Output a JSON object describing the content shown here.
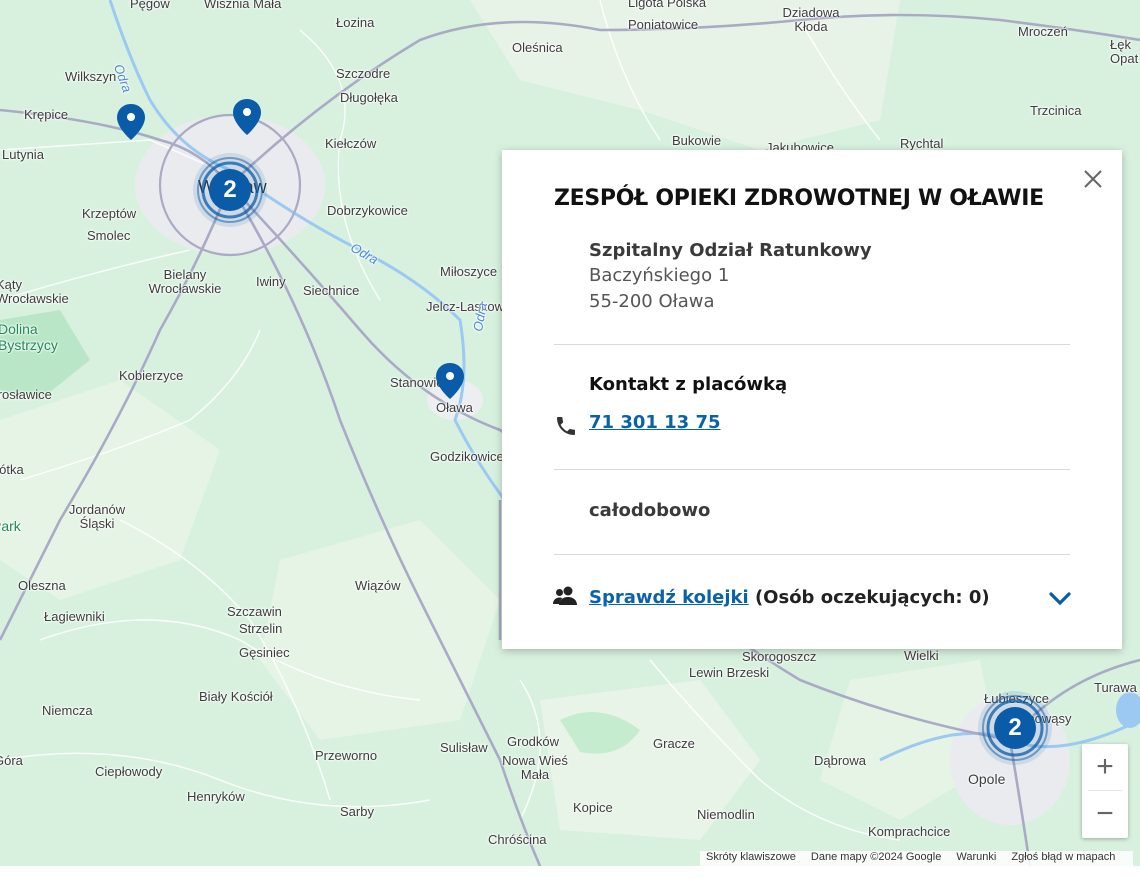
{
  "map": {
    "places": [
      {
        "text": "Pęgów",
        "cls": ""
      },
      {
        "text": "Wisznia Mała",
        "cls": ""
      },
      {
        "text": "Łozina",
        "cls": ""
      },
      {
        "text": "Ligota Polska",
        "cls": ""
      },
      {
        "text": "Poniatowice",
        "cls": ""
      },
      {
        "text": "Dziadowa Kłoda",
        "cls": ""
      },
      {
        "text": "Mroczeń",
        "cls": ""
      },
      {
        "text": "Łęk Opat",
        "cls": ""
      },
      {
        "text": "Oleśnica",
        "cls": ""
      },
      {
        "text": "Wilkszyn",
        "cls": ""
      },
      {
        "text": "Szczodre",
        "cls": ""
      },
      {
        "text": "Długołęka",
        "cls": ""
      },
      {
        "text": "Trzcinica",
        "cls": ""
      },
      {
        "text": "Krępice",
        "cls": ""
      },
      {
        "text": "Kiełczów",
        "cls": ""
      },
      {
        "text": "Bukowie",
        "cls": ""
      },
      {
        "text": "Jakubowice",
        "cls": ""
      },
      {
        "text": "Rychtal",
        "cls": ""
      },
      {
        "text": "Lutynia",
        "cls": ""
      },
      {
        "text": "Wrocław",
        "cls": "big"
      },
      {
        "text": "Krzeptów",
        "cls": ""
      },
      {
        "text": "Dobrzykowice",
        "cls": ""
      },
      {
        "text": "Smolec",
        "cls": ""
      },
      {
        "text": "Bielany Wrocławskie",
        "cls": ""
      },
      {
        "text": "Iwiny",
        "cls": ""
      },
      {
        "text": "Siechnice",
        "cls": ""
      },
      {
        "text": "Miłoszyce",
        "cls": ""
      },
      {
        "text": "Jelcz-Laskowice",
        "cls": ""
      },
      {
        "text": "Kąty Wrocławskie",
        "cls": ""
      },
      {
        "text": "Dolina Bystrzycy",
        "cls": "park"
      },
      {
        "text": "Kobierzyce",
        "cls": ""
      },
      {
        "text": "Stanowice",
        "cls": ""
      },
      {
        "text": "Oława",
        "cls": ""
      },
      {
        "text": "Mirosławice",
        "cls": ""
      },
      {
        "text": "Godzikowice",
        "cls": ""
      },
      {
        "text": "Sobótka",
        "cls": ""
      },
      {
        "text": "Jordanów Śląski",
        "cls": ""
      },
      {
        "text": "Park",
        "cls": "park"
      },
      {
        "text": "Oleszna",
        "cls": ""
      },
      {
        "text": "Wiązów",
        "cls": ""
      },
      {
        "text": "Łagiewniki",
        "cls": ""
      },
      {
        "text": "Szczawin",
        "cls": ""
      },
      {
        "text": "Strzelin",
        "cls": ""
      },
      {
        "text": "Gęsiniec",
        "cls": ""
      },
      {
        "text": "Skorogoszcz",
        "cls": ""
      },
      {
        "text": "Lewin Brzeski",
        "cls": ""
      },
      {
        "text": "Wielki",
        "cls": ""
      },
      {
        "text": "Łubieszyce",
        "cls": ""
      },
      {
        "text": "Turawa",
        "cls": ""
      },
      {
        "text": "Czarnowąsy",
        "cls": ""
      },
      {
        "text": "Biały Kościół",
        "cls": ""
      },
      {
        "text": "Niemcza",
        "cls": ""
      },
      {
        "text": "Przeworno",
        "cls": ""
      },
      {
        "text": "Sulisław",
        "cls": ""
      },
      {
        "text": "Grodków",
        "cls": ""
      },
      {
        "text": "Nowa Wieś Mała",
        "cls": ""
      },
      {
        "text": "Gracze",
        "cls": ""
      },
      {
        "text": "Dąbrowa",
        "cls": ""
      },
      {
        "text": "Opole",
        "cls": "big"
      },
      {
        "text": "Góra",
        "cls": ""
      },
      {
        "text": "Ciepłowody",
        "cls": ""
      },
      {
        "text": "Henryków",
        "cls": ""
      },
      {
        "text": "Sarby",
        "cls": ""
      },
      {
        "text": "Kopice",
        "cls": ""
      },
      {
        "text": "Niemodlin",
        "cls": ""
      },
      {
        "text": "Komprachcice",
        "cls": ""
      },
      {
        "text": "Chróścina",
        "cls": ""
      },
      {
        "text": "Odra",
        "cls": "water"
      },
      {
        "text": "Odra",
        "cls": "water"
      },
      {
        "text": "Odra",
        "cls": "water"
      }
    ],
    "clusters": [
      {
        "count": "2"
      },
      {
        "count": "2"
      }
    ],
    "pin_color": "#0a5ca8",
    "cluster_color": "#0a5ca8"
  },
  "popup": {
    "title": "ZESPÓŁ OPIEKI ZDROWOTNEJ W OŁAWIE",
    "department": "Szpitalny Odział Ratunkowy",
    "street": "Baczyńskiego 1",
    "city": "55-200 Oława",
    "contact_title": "Kontakt z placówką",
    "phone": "71 301 13 75",
    "hours": "całodobowo",
    "queue_link": "Sprawdź kolejki",
    "queue_count": "(Osób oczekujących: 0)"
  },
  "zoom": {
    "in_label": "+",
    "out_label": "−"
  },
  "attribution": {
    "shortcuts": "Skróty klawiszowe",
    "data": "Dane mapy ©2024 Google",
    "terms": "Warunki",
    "report": "Zgłoś błąd w mapach"
  }
}
